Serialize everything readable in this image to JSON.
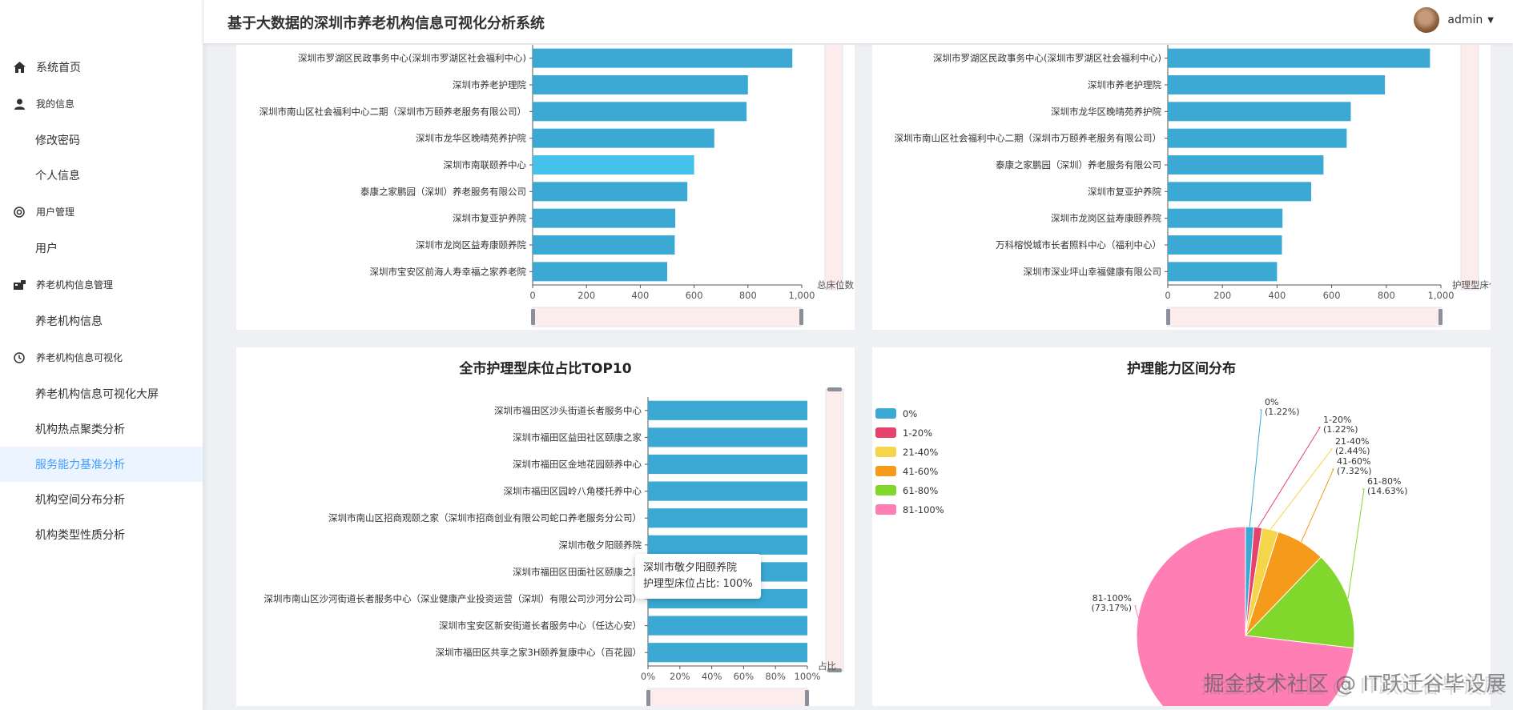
{
  "header": {
    "title": "基于大数据的深圳市养老机构信息可视化分析系统",
    "username": "admin"
  },
  "sidebar": {
    "items": [
      {
        "label": "系统首页",
        "icon": "home-icon",
        "kind": "top"
      },
      {
        "label": "我的信息",
        "icon": "user-icon",
        "kind": "group"
      },
      {
        "label": "修改密码",
        "kind": "sub"
      },
      {
        "label": "个人信息",
        "kind": "sub"
      },
      {
        "label": "用户管理",
        "icon": "circle-icon",
        "kind": "group"
      },
      {
        "label": "用户",
        "kind": "sub"
      },
      {
        "label": "养老机构信息管理",
        "icon": "briefcase-icon",
        "kind": "group"
      },
      {
        "label": "养老机构信息",
        "kind": "sub"
      },
      {
        "label": "养老机构信息可视化",
        "icon": "clock-icon",
        "kind": "group"
      },
      {
        "label": "养老机构信息可视化大屏",
        "kind": "sub"
      },
      {
        "label": "机构热点聚类分析",
        "kind": "sub"
      },
      {
        "label": "服务能力基准分析",
        "kind": "sub",
        "active": true
      },
      {
        "label": "机构空间分布分析",
        "kind": "sub"
      },
      {
        "label": "机构类型性质分析",
        "kind": "sub"
      }
    ]
  },
  "colors": {
    "bar": "#3ba9d4",
    "bar_highlight": "#45c2ea",
    "active_menu_bg": "#ecf5ff",
    "active_menu_text": "#409eff",
    "zoom_fill": "#fdecec"
  },
  "chart_data": [
    {
      "type": "bar",
      "orientation": "horizontal",
      "categories": [
        "深圳市罗湖区民政事务中心(深圳市罗湖区社会福利中心)",
        "深圳市养老护理院",
        "深圳市南山区社会福利中心二期（深圳市万颐养老服务有限公司）",
        "深圳市龙华区晚晴苑养护院",
        "深圳市南联颐养中心",
        "泰康之家鹏园（深圳）养老服务有限公司",
        "深圳市复亚护养院",
        "深圳市龙岗区益寿康颐养院",
        "深圳市宝安区前海人寿幸福之家养老院"
      ],
      "values": [
        965,
        800,
        795,
        675,
        600,
        575,
        530,
        528,
        500
      ],
      "highlighted_index": 4,
      "xlim": [
        0,
        1000
      ],
      "xticks": [
        "0",
        "200",
        "400",
        "600",
        "800",
        "1,000"
      ],
      "xlabel": "总床位数",
      "zoom_range": [
        0,
        100
      ]
    },
    {
      "type": "bar",
      "orientation": "horizontal",
      "categories": [
        "深圳市罗湖区民政事务中心(深圳市罗湖区社会福利中心)",
        "深圳市养老护理院",
        "深圳市龙华区晚晴苑养护院",
        "深圳市南山区社会福利中心二期（深圳市万颐养老服务有限公司）",
        "泰康之家鹏园（深圳）养老服务有限公司",
        "深圳市复亚护养院",
        "深圳市龙岗区益寿康颐养院",
        "万科榕悦城市长者照料中心（福利中心）",
        "深圳市深业坪山幸福健康有限公司"
      ],
      "values": [
        960,
        795,
        670,
        655,
        570,
        525,
        420,
        418,
        400
      ],
      "xlim": [
        0,
        1000
      ],
      "xticks": [
        "0",
        "200",
        "400",
        "600",
        "800",
        "1,000"
      ],
      "xlabel": "护理型床位",
      "zoom_range": [
        0,
        100
      ]
    },
    {
      "type": "bar",
      "orientation": "horizontal",
      "title": "全市护理型床位占比TOP10",
      "categories": [
        "深圳市福田区沙头街道长者服务中心",
        "深圳市福田区益田社区颐康之家",
        "深圳市福田区金地花园颐养中心",
        "深圳市福田区园岭八角楼托养中心",
        "深圳市南山区招商观颐之家（深圳市招商创业有限公司蛇口养老服务分公司）",
        "深圳市敬夕阳颐养院",
        "深圳市福田区田面社区颐康之家",
        "深圳市南山区沙河街道长者服务中心（深业健康产业投资运营（深圳）有限公司沙河分公司）",
        "深圳市宝安区新安街道长者服务中心（任达心安）",
        "深圳市福田区共享之家3H颐养复康中心（百花园）"
      ],
      "values": [
        100,
        100,
        100,
        100,
        100,
        100,
        100,
        100,
        100,
        100
      ],
      "xlim": [
        0,
        100
      ],
      "xticks": [
        "0%",
        "20%",
        "40%",
        "60%",
        "80%",
        "100%"
      ],
      "xlabel": "占比",
      "zoom_range": [
        0,
        100
      ],
      "tooltip": {
        "name": "深圳市敬夕阳颐养院",
        "label": "护理型床位占比: 100%"
      }
    },
    {
      "type": "pie",
      "title": "护理能力区间分布",
      "slices": [
        {
          "name": "0%",
          "value": 1.22,
          "label": "(1.22%)",
          "color": "#3ba9d4"
        },
        {
          "name": "1-20%",
          "value": 1.22,
          "label": "(1.22%)",
          "color": "#e8426c"
        },
        {
          "name": "21-40%",
          "value": 2.44,
          "label": "(2.44%)",
          "color": "#f5d64a"
        },
        {
          "name": "41-60%",
          "value": 7.32,
          "label": "(7.32%)",
          "color": "#f59a1b"
        },
        {
          "name": "61-80%",
          "value": 14.63,
          "label": "(14.63%)",
          "color": "#82d72c"
        },
        {
          "name": "81-100%",
          "value": 73.17,
          "label": "(73.17%)",
          "color": "#ff7fb4"
        }
      ],
      "legend": "left"
    }
  ],
  "watermark": "掘金技术社区 @ IT跃迁谷毕设展"
}
